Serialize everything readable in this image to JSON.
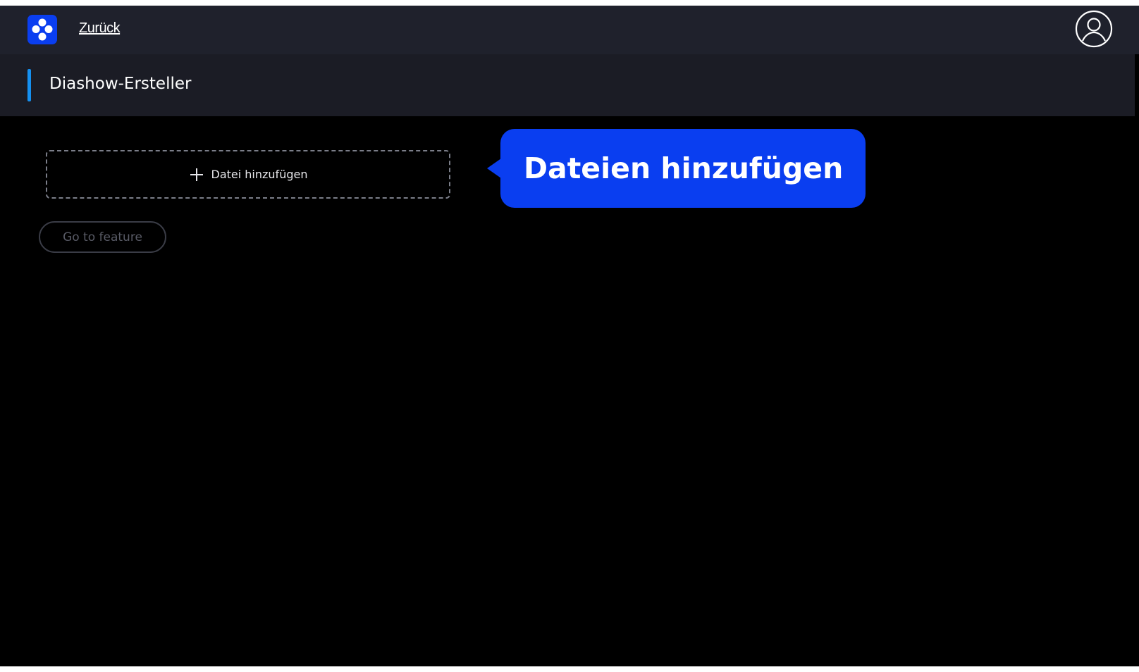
{
  "topbar": {
    "back_label": "Zurück",
    "logo_icon": "flower-logo-icon",
    "user_icon": "user-account-icon"
  },
  "header": {
    "title": "Diashow-Ersteller",
    "accent_color": "#1590f0"
  },
  "upload": {
    "add_file_label": "Datei hinzufügen",
    "icon": "plus-icon"
  },
  "tooltip": {
    "text": "Dateien hinzufügen",
    "color": "#0a3ef0"
  },
  "actions": {
    "go_to_feature_label": "Go to feature"
  }
}
